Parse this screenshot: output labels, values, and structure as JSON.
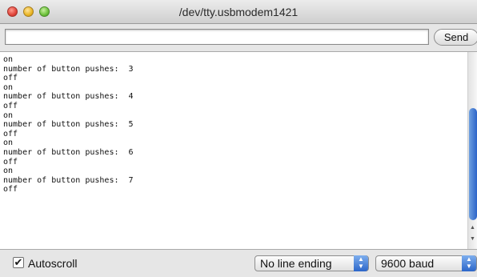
{
  "window": {
    "title": "/dev/tty.usbmodem1421"
  },
  "input": {
    "value": "",
    "send_label": "Send"
  },
  "output": {
    "lines": [
      "on",
      "number of button pushes:  3",
      "off",
      "on",
      "number of button pushes:  4",
      "off",
      "on",
      "number of button pushes:  5",
      "off",
      "on",
      "number of button pushes:  6",
      "off",
      "on",
      "number of button pushes:  7",
      "off"
    ]
  },
  "footer": {
    "autoscroll_label": "Autoscroll",
    "autoscroll_checked": true,
    "line_ending": "No line ending",
    "baud": "9600 baud"
  },
  "icons": {
    "close": "close-icon",
    "minimize": "minimize-icon",
    "zoom": "zoom-icon",
    "check": "checkmark-icon",
    "stepper": "stepper-arrows-icon"
  },
  "colors": {
    "scroll_thumb": "#2c64c8",
    "traffic_red": "#e0443a",
    "traffic_yellow": "#e9b524",
    "traffic_green": "#6cc13a"
  }
}
